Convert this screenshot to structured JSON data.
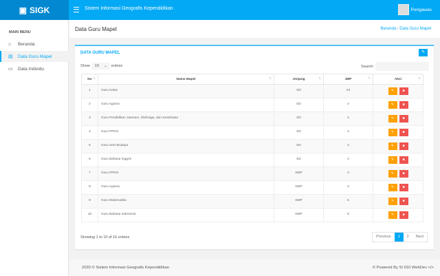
{
  "app": {
    "logo": "SIGK",
    "title": "Sistem Informasi Geografis Kependidikan",
    "user": "Pengawas"
  },
  "sidebar": {
    "heading": "MAIN MENU",
    "items": [
      {
        "label": "Beranda",
        "icon": "home-icon"
      },
      {
        "label": "Data Guru Mapel",
        "icon": "file-icon",
        "active": true
      },
      {
        "label": "Data Individu",
        "icon": "id-card-icon"
      }
    ]
  },
  "page": {
    "title": "Data Guru Mapel",
    "breadcrumb": [
      "Beranda",
      "Data Guru Mapel"
    ]
  },
  "card": {
    "title": "DATA GURU MAPEL",
    "show_label": "Show",
    "entries_value": "10",
    "entries_label": "entries",
    "search_label": "Search:",
    "search_value": ""
  },
  "table": {
    "columns": [
      "No",
      "Nama Mapel",
      "Jenjang",
      "JMP",
      "Aksi"
    ],
    "rows": [
      [
        "1",
        "Guru Kelas",
        "SD",
        "24"
      ],
      [
        "2",
        "Guru Agama",
        "SD",
        "4"
      ],
      [
        "3",
        "Guru Pendidikan Jasmani, Olahraga, dan Kesehatan",
        "SD",
        "4"
      ],
      [
        "4",
        "Guru PPKN",
        "SD",
        "4"
      ],
      [
        "5",
        "Guru Seni Budaya",
        "SD",
        "4"
      ],
      [
        "6",
        "Guru Bahasa Inggris",
        "SD",
        "4"
      ],
      [
        "7",
        "Guru PPKN",
        "SMP",
        "3"
      ],
      [
        "8",
        "Guru Agama",
        "SMP",
        "3"
      ],
      [
        "9",
        "Guru Matematika",
        "SMP",
        "5"
      ],
      [
        "10",
        "Guru Bahasa Indonesia",
        "SMP",
        "6"
      ]
    ]
  },
  "pagination": {
    "info": "Showing 1 to 10 of 16 entries",
    "previous": "Previous",
    "pages": [
      "1",
      "2"
    ],
    "next": "Next"
  },
  "footer": {
    "left": "2020 © Sistem Informasi Geografis Kependidikan",
    "right": "© Powered By SI 010 WebDev </>"
  }
}
